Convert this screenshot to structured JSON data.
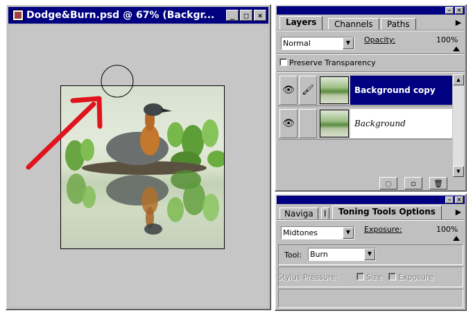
{
  "document": {
    "title": "Dodge&Burn.psd @ 67%  (Backgr...",
    "minimize": "_",
    "maximize": "□",
    "close": "×"
  },
  "layers_panel": {
    "tabs": [
      "Layers",
      "Channels",
      "Paths"
    ],
    "active_tab": "Layers",
    "blend_mode": "Normal",
    "opacity_label": "Opacity:",
    "opacity_value": "100%",
    "preserve_transparency_label": "Preserve Transparency",
    "layers": [
      {
        "name": "Background copy",
        "selected": true,
        "visible": true
      },
      {
        "name": "Background",
        "selected": false,
        "visible": true
      }
    ]
  },
  "toning_panel": {
    "tabs": [
      "Naviga",
      "I",
      "Toning Tools Options"
    ],
    "active_tab": "Toning Tools Options",
    "range": "Midtones",
    "exposure_label": "Exposure:",
    "exposure_value": "100%",
    "tool_label": "Tool:",
    "tool_value": "Burn",
    "stylus_pressure_label": "Stylus Pressure:",
    "size_label": "Size",
    "exposure_checkbox_label": "Exposure"
  },
  "colors": {
    "titlebar": "#000080",
    "selection": "#000080",
    "annotation_arrow": "#e0141c"
  }
}
